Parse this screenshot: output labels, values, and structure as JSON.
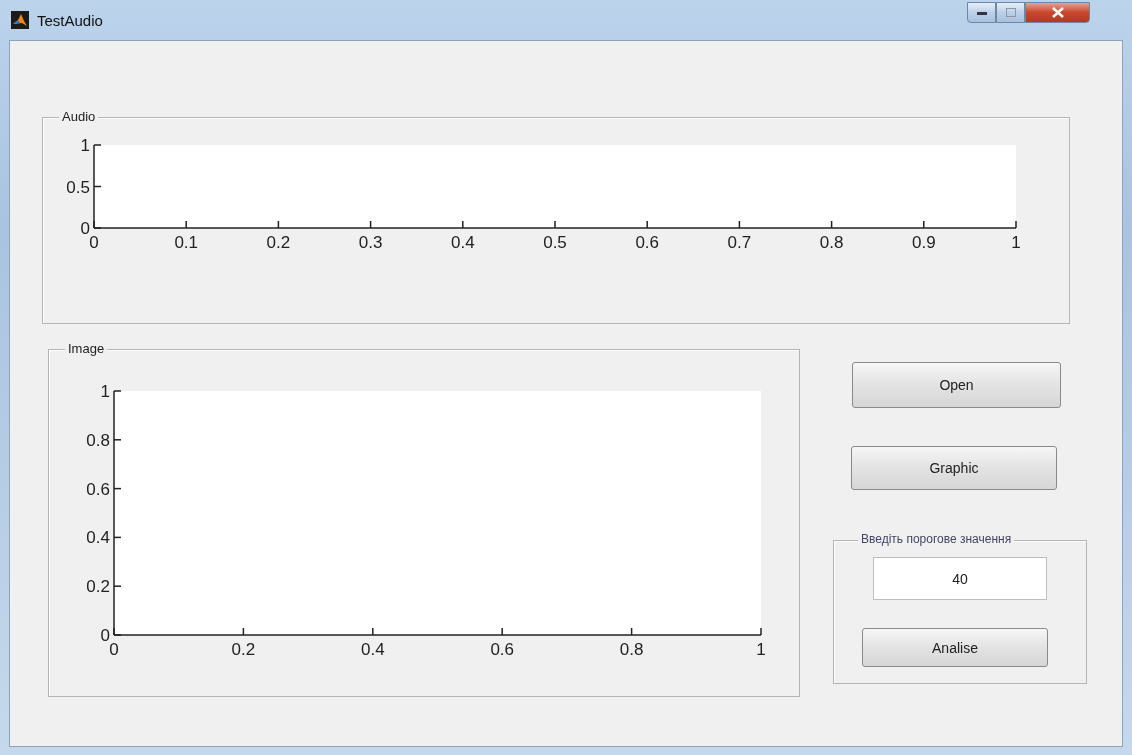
{
  "window": {
    "title": "TestAudio"
  },
  "audio_panel": {
    "title": "Audio",
    "chart_data": {
      "type": "line",
      "xlim": [
        0,
        1
      ],
      "ylim": [
        0,
        1
      ],
      "xticks": [
        0,
        0.1,
        0.2,
        0.3,
        0.4,
        0.5,
        0.6,
        0.7,
        0.8,
        0.9,
        1
      ],
      "yticks": [
        0,
        0.5,
        1
      ]
    }
  },
  "image_panel": {
    "title": "Image",
    "chart_data": {
      "type": "line",
      "xlim": [
        0,
        1
      ],
      "ylim": [
        0,
        1
      ],
      "xticks": [
        0,
        0.2,
        0.4,
        0.6,
        0.8,
        1
      ],
      "yticks": [
        0,
        0.2,
        0.4,
        0.6,
        0.8,
        1
      ]
    }
  },
  "buttons": [
    "Open",
    "Graphic"
  ],
  "threshold_panel": {
    "title": "Введіть порогове значення",
    "value": "40",
    "button": "Analise"
  }
}
